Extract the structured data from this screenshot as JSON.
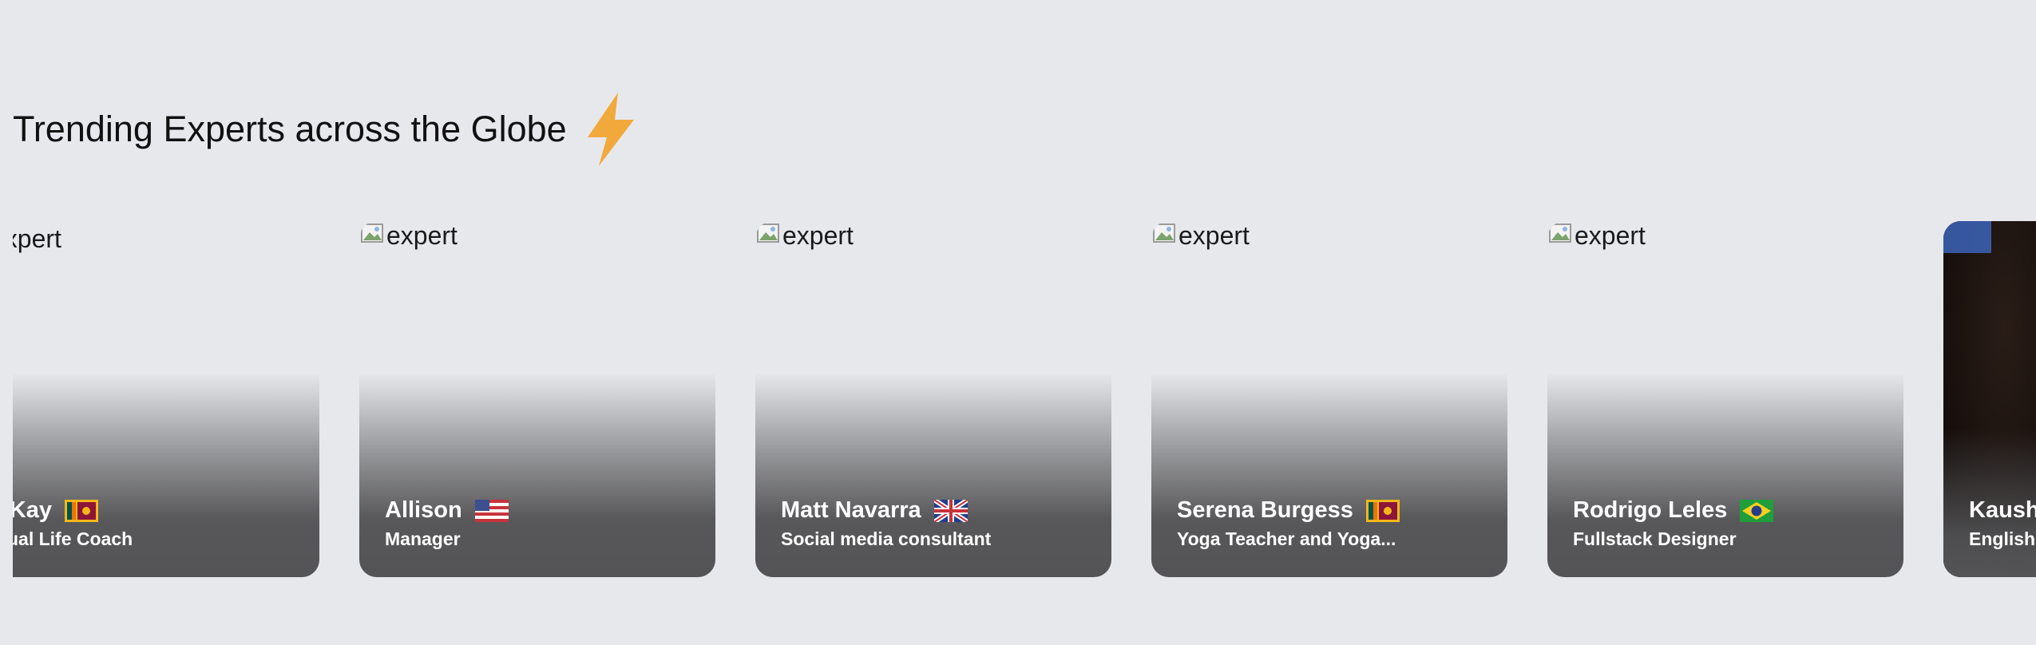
{
  "section": {
    "title": "Trending Experts across the Globe",
    "icon": "lightning-bolt-icon"
  },
  "experts": [
    {
      "image_alt": "expert",
      "name": "Kay",
      "name_visible": "n Kay",
      "role": "ritual Life Coach",
      "flag": "sri-lanka-flag-icon"
    },
    {
      "image_alt": "expert",
      "name": "Allison",
      "role": "Manager",
      "flag": "usa-flag-icon"
    },
    {
      "image_alt": "expert",
      "name": "Matt Navarra",
      "role": "Social media consultant",
      "flag": "uk-flag-icon"
    },
    {
      "image_alt": "expert",
      "name": "Serena Burgess",
      "role": "Yoga Teacher and Yoga...",
      "flag": "sri-lanka-flag-icon"
    },
    {
      "image_alt": "expert",
      "name": "Rodrigo Leles",
      "role": "Fullstack Designer",
      "flag": "brazil-flag-icon"
    },
    {
      "name": "Kausha",
      "role": "English t",
      "has_photo": true
    }
  ],
  "colors": {
    "background": "#e7e8ec",
    "bolt": "#f2a93b",
    "card_shade": "#545456"
  }
}
